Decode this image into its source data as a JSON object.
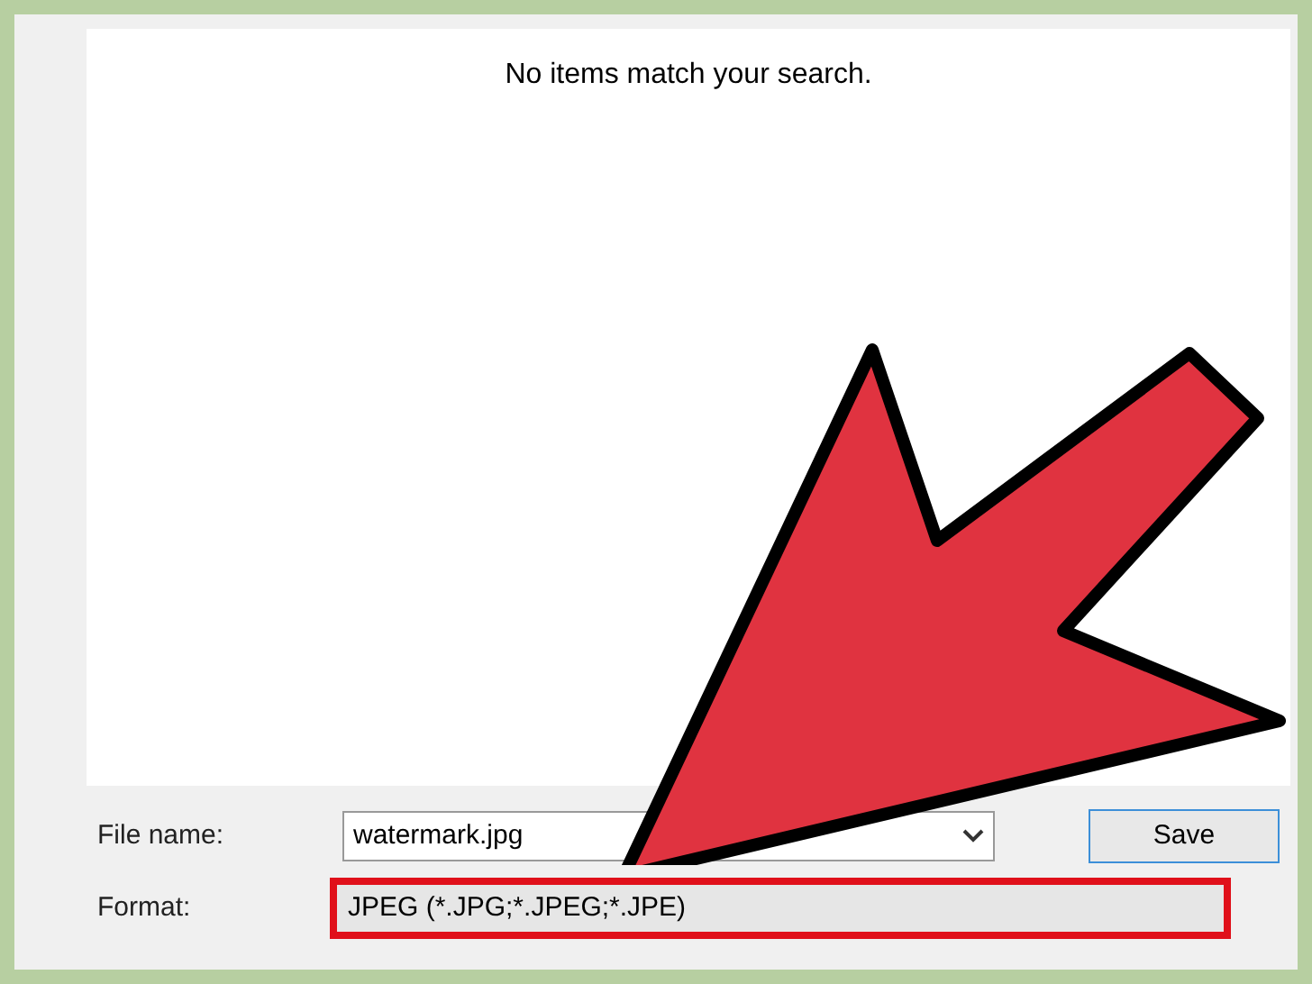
{
  "results": {
    "message": "No items match your search."
  },
  "file_name": {
    "label": "File name:",
    "value": "watermark.jpg"
  },
  "format": {
    "label": "Format:",
    "value": "JPEG (*.JPG;*.JPEG;*.JPE)",
    "highlighted": true
  },
  "buttons": [
    {
      "label": "Save"
    }
  ]
}
